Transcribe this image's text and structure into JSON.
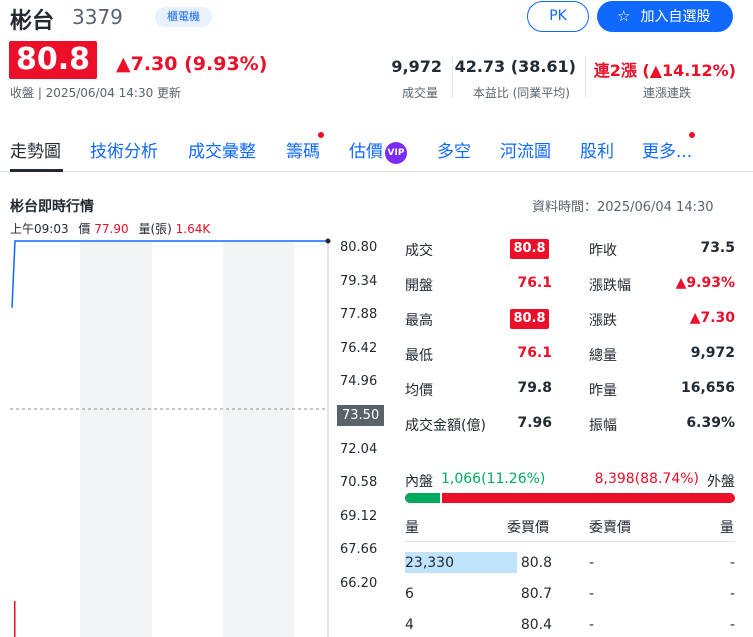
{
  "stock": {
    "name": "彬台",
    "code": "3379",
    "tag": "櫃電機",
    "pk_label": "PK",
    "add_label": "加入自選股",
    "price": "80.8",
    "change": "▲7.30 (9.93%)",
    "close_info": "收盤 | 2025/06/04 14:30 更新"
  },
  "stats": [
    {
      "value": "9,972",
      "label": "成交量"
    },
    {
      "value": "42.73 (38.61)",
      "label": "本益比 (同業平均)"
    },
    {
      "value": "連2漲 (▲14.12%)",
      "label": "連漲連跌"
    }
  ],
  "tabs": [
    "走勢圖",
    "技術分析",
    "成交彙整",
    "籌碼",
    "估價",
    "多空",
    "河流圖",
    "股利",
    "更多..."
  ],
  "vip_badge": "VIP",
  "realtime": {
    "title": "彬台即時行情",
    "data_time": "資料時間：2025/06/04 14:30",
    "hover_time": "上午09:03",
    "hover_price_label": "價",
    "hover_price": "77.90",
    "hover_vol_label": "量(張)",
    "hover_vol": "1.64K"
  },
  "chart_data": {
    "type": "line",
    "yticks": [
      "80.80",
      "79.34",
      "77.88",
      "76.42",
      "74.96",
      "73.50",
      "72.04",
      "70.58",
      "69.12",
      "67.66",
      "66.20"
    ],
    "ylim": [
      66.2,
      80.8
    ],
    "reference_price": "73.50",
    "series": [
      {
        "values": [
          77.9,
          80.8,
          80.8,
          80.8,
          80.8,
          80.8,
          80.8,
          80.8,
          80.8
        ]
      }
    ]
  },
  "quote": {
    "left": [
      {
        "label": "成交",
        "value": "80.8",
        "pill": true
      },
      {
        "label": "開盤",
        "value": "76.1"
      },
      {
        "label": "最高",
        "value": "80.8",
        "pill": true
      },
      {
        "label": "最低",
        "value": "76.1"
      },
      {
        "label": "均價",
        "value": "79.8"
      },
      {
        "label": "成交金額(億)",
        "value": "7.96"
      }
    ],
    "right": [
      {
        "label": "昨收",
        "value": "73.5"
      },
      {
        "label": "漲跌幅",
        "value": "▲9.93%"
      },
      {
        "label": "漲跌",
        "value": "▲7.30"
      },
      {
        "label": "總量",
        "value": "9,972"
      },
      {
        "label": "昨量",
        "value": "16,656"
      },
      {
        "label": "振幅",
        "value": "6.39%"
      }
    ]
  },
  "inout": {
    "in_label": "內盤",
    "in_value": "1,066(11.26%)",
    "out_value": "8,398(88.74%)",
    "out_label": "外盤",
    "in_fraction": 0.1126
  },
  "orderbook": {
    "headers": [
      "量",
      "委買價",
      "委賣價",
      "量"
    ],
    "rows": [
      {
        "bid_vol": "23,330",
        "bid": "80.8",
        "ask": "-",
        "ask_vol": "-"
      },
      {
        "bid_vol": "6",
        "bid": "80.7",
        "ask": "-",
        "ask_vol": "-"
      },
      {
        "bid_vol": "4",
        "bid": "80.4",
        "ask": "-",
        "ask_vol": "-"
      }
    ]
  },
  "colors": {
    "up": "#eb0f29",
    "down": "#00ab5e",
    "accent": "#0f69ff",
    "line": "#0f69ff"
  }
}
